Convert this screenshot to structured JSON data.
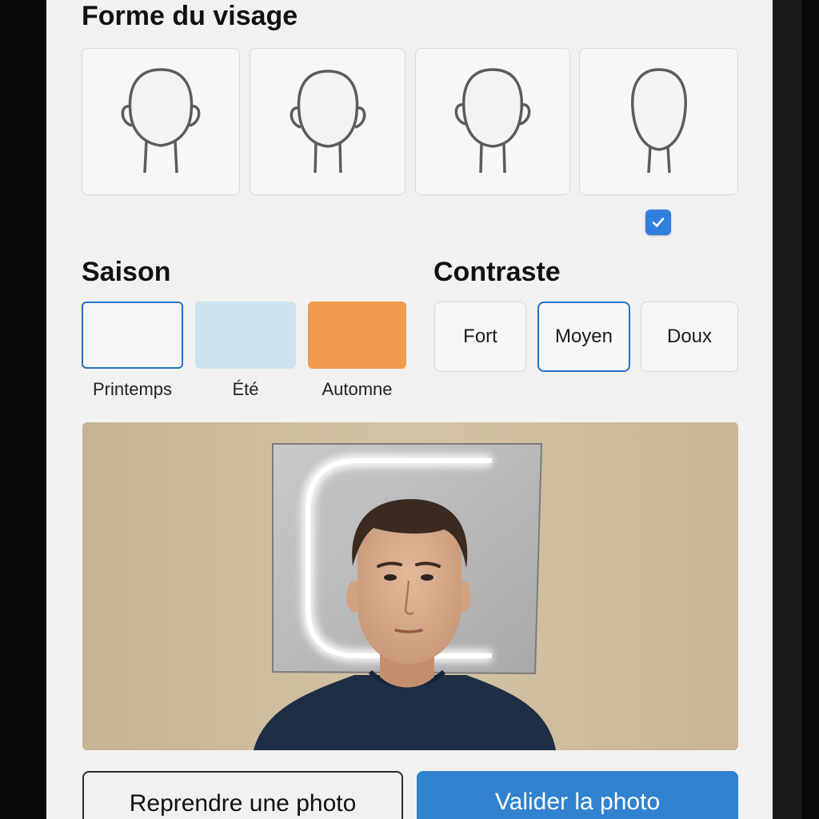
{
  "face_shape": {
    "title": "Forme du visage",
    "options": [
      {
        "icon": "face-outline-icon",
        "selected": false
      },
      {
        "icon": "face-outline-icon",
        "selected": false
      },
      {
        "icon": "face-outline-icon",
        "selected": false
      },
      {
        "icon": "face-outline-icon",
        "selected": true
      }
    ]
  },
  "season": {
    "title": "Saison",
    "options": [
      {
        "label": "Printemps",
        "color": "#f7f7f7",
        "selected": true
      },
      {
        "label": "Été",
        "color": "#cbe3ef",
        "selected": false
      },
      {
        "label": "Automne",
        "color": "#f09a50",
        "selected": false
      }
    ]
  },
  "contrast": {
    "title": "Contraste",
    "options": [
      {
        "label": "Fort",
        "selected": false
      },
      {
        "label": "Moyen",
        "selected": true
      },
      {
        "label": "Doux",
        "selected": false
      }
    ]
  },
  "actions": {
    "retake_label": "Reprendre une photo",
    "confirm_label": "Valider la photo"
  },
  "colors": {
    "accent": "#3182cf",
    "selection_border": "#2a6fc4",
    "photo_wall": "#cbb898"
  }
}
